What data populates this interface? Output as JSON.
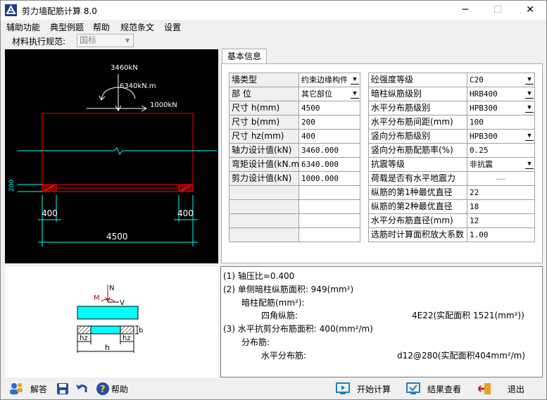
{
  "window": {
    "title": "剪力墙配筋计算 8.0",
    "controls": {
      "minimize": "─",
      "maximize": "☐",
      "close": "✕"
    }
  },
  "menu": [
    "辅助功能",
    "典型例题",
    "帮助",
    "规范条文",
    "设置"
  ],
  "standard": {
    "label": "材料执行规范:",
    "value": "国标"
  },
  "elevation": {
    "load_n": "3460kN",
    "load_m": "6340kN.m",
    "load_v": "1000kN",
    "dim_hz_left": "400",
    "dim_hz_right": "400",
    "dim_h": "4500",
    "dim_b": "200"
  },
  "section_sketch": {
    "label_m": "M",
    "label_n": "N",
    "label_v": "V",
    "label_b": "b",
    "label_hz_left": "hz",
    "label_hz_right": "hz",
    "label_h": "h"
  },
  "tab": {
    "label": "基本信息"
  },
  "left_table": [
    {
      "label": "墙类型",
      "value": "约束边缘构件",
      "dropdown": true
    },
    {
      "label": "部 位",
      "value": "其它部位",
      "dropdown": true
    },
    {
      "label": "尺寸 h(mm)",
      "value": "4500"
    },
    {
      "label": "尺寸 b(mm)",
      "value": "200"
    },
    {
      "label": "尺寸 hz(mm)",
      "value": "400"
    },
    {
      "label": "轴力设计值(kN)",
      "value": "3460.000"
    },
    {
      "label": "弯矩设计值(kN.m)",
      "value": "6340.000"
    },
    {
      "label": "剪力设计值(kN)",
      "value": "1000.000"
    },
    {
      "label": "",
      "value": ""
    },
    {
      "label": "",
      "value": ""
    },
    {
      "label": "",
      "value": ""
    },
    {
      "label": "",
      "value": ""
    }
  ],
  "right_table": [
    {
      "label": "砼强度等级",
      "value": "C20",
      "dropdown": true
    },
    {
      "label": "暗柱纵筋级别",
      "value": "HRB400",
      "dropdown": true
    },
    {
      "label": "水平分布筋级别",
      "value": "HPB300",
      "dropdown": true
    },
    {
      "label": "水平分布筋间距(mm)",
      "value": "100"
    },
    {
      "label": "竖向分布筋级别",
      "value": "HPB300",
      "dropdown": true
    },
    {
      "label": "竖向分布筋配筋率(%)",
      "value": "0.25"
    },
    {
      "label": "抗震等级",
      "value": "非抗震",
      "dropdown": true
    },
    {
      "label": "荷载是否有水平地震力",
      "value": "——"
    },
    {
      "label": "纵筋的第1种最优直径",
      "value": "22"
    },
    {
      "label": "纵筋的第2种最优直径",
      "value": "18"
    },
    {
      "label": "水平分布筋直径(mm)",
      "value": "12"
    },
    {
      "label": "选筋时计算面积放大系数",
      "value": "1.00"
    }
  ],
  "results": {
    "line1": "(1) 轴压比=0.400",
    "line2": "(2) 单侧暗柱纵筋面积: 949(mm²)",
    "line3": "暗柱配筋(mm²):",
    "line4_label": "四角纵筋:",
    "line4_value": "4E22(实配面积 1521(mm²))",
    "line5": "(3) 水平抗剪分布筋面积: 400(mm²/m)",
    "line6": "分布筋:",
    "line7_label": "水平分布筋:",
    "line7_value": "d12@280(实配面积404mm²/m)"
  },
  "bottom": {
    "answer": "解答",
    "help": "帮助",
    "start": "开始计算",
    "view": "结果查看",
    "exit": "退出"
  },
  "colors": {
    "cad_bg": "#000000",
    "cad_white": "#ffffff",
    "cad_cyan": "#00ffff",
    "cad_red": "#ff0000",
    "cad_dim": "#00e0ff"
  }
}
